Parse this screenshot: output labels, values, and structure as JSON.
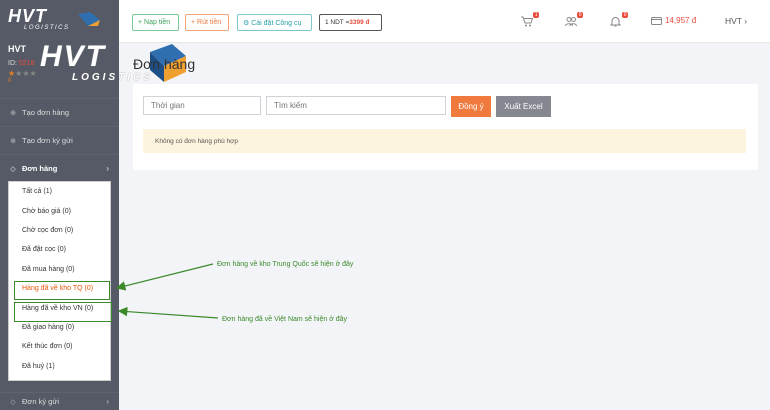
{
  "logo": {
    "text": "HVT",
    "sub": "LOGISTICS"
  },
  "user": {
    "name": "HVT",
    "id_label": "ID:",
    "id_value": "0218",
    "points": "0",
    "stars_filled": "★",
    "stars_empty": "★★★"
  },
  "sidebar": {
    "items": [
      {
        "label": "Tạo đơn hàng",
        "icon": "plus-circle-icon"
      },
      {
        "label": "Tạo đơn ký gửi",
        "icon": "plus-circle-icon"
      },
      {
        "label": "Đơn hàng",
        "icon": "tag-icon"
      }
    ],
    "bottom_item": {
      "label": "Đơn ký gửi",
      "icon": "tag-icon"
    },
    "chevron": "›",
    "submenu": [
      "Tất cả (1)",
      "Chờ báo giá (0)",
      "Chờ cọc đơn (0)",
      "Đã đặt cọc (0)",
      "Đã mua hàng (0)",
      "Hàng đã về kho TQ (0)",
      "Hàng đã về kho VN (0)",
      "Đã giao hàng (0)",
      "Kết thúc đơn (0)",
      "Đã huỷ (1)"
    ]
  },
  "header": {
    "nap_label": "+ Nạp tiền",
    "rut_label": "+ Rút tiền",
    "cai_label": "⚙ Cài đặt Công cụ",
    "rate_prefix": "1 NDT = ",
    "rate_value": "3399 đ",
    "cart_badge": "1",
    "users_badge": "0",
    "bell_badge": "0",
    "wallet": "14,957 đ",
    "user_menu": "HVT ›"
  },
  "main": {
    "title": "Đơn hàng",
    "time_placeholder": "Thời gian",
    "search_placeholder": "Tìm kiếm",
    "ok_label": "Đồng ý",
    "excel_label": "Xuất Excel",
    "empty_message": "Không có đơn hàng phù hợp"
  },
  "annotations": {
    "tq": "Đơn hàng về kho Trung Quốc sẽ hiện ở đây",
    "vn": "Đơn hàng đã về Việt Nam sẽ hiện ở đây"
  },
  "colors": {
    "sidebar": "#555a66",
    "accent_orange": "#f07a3d",
    "annotation_green": "#3a8a2a",
    "alert_bg": "#fcf4dc"
  }
}
